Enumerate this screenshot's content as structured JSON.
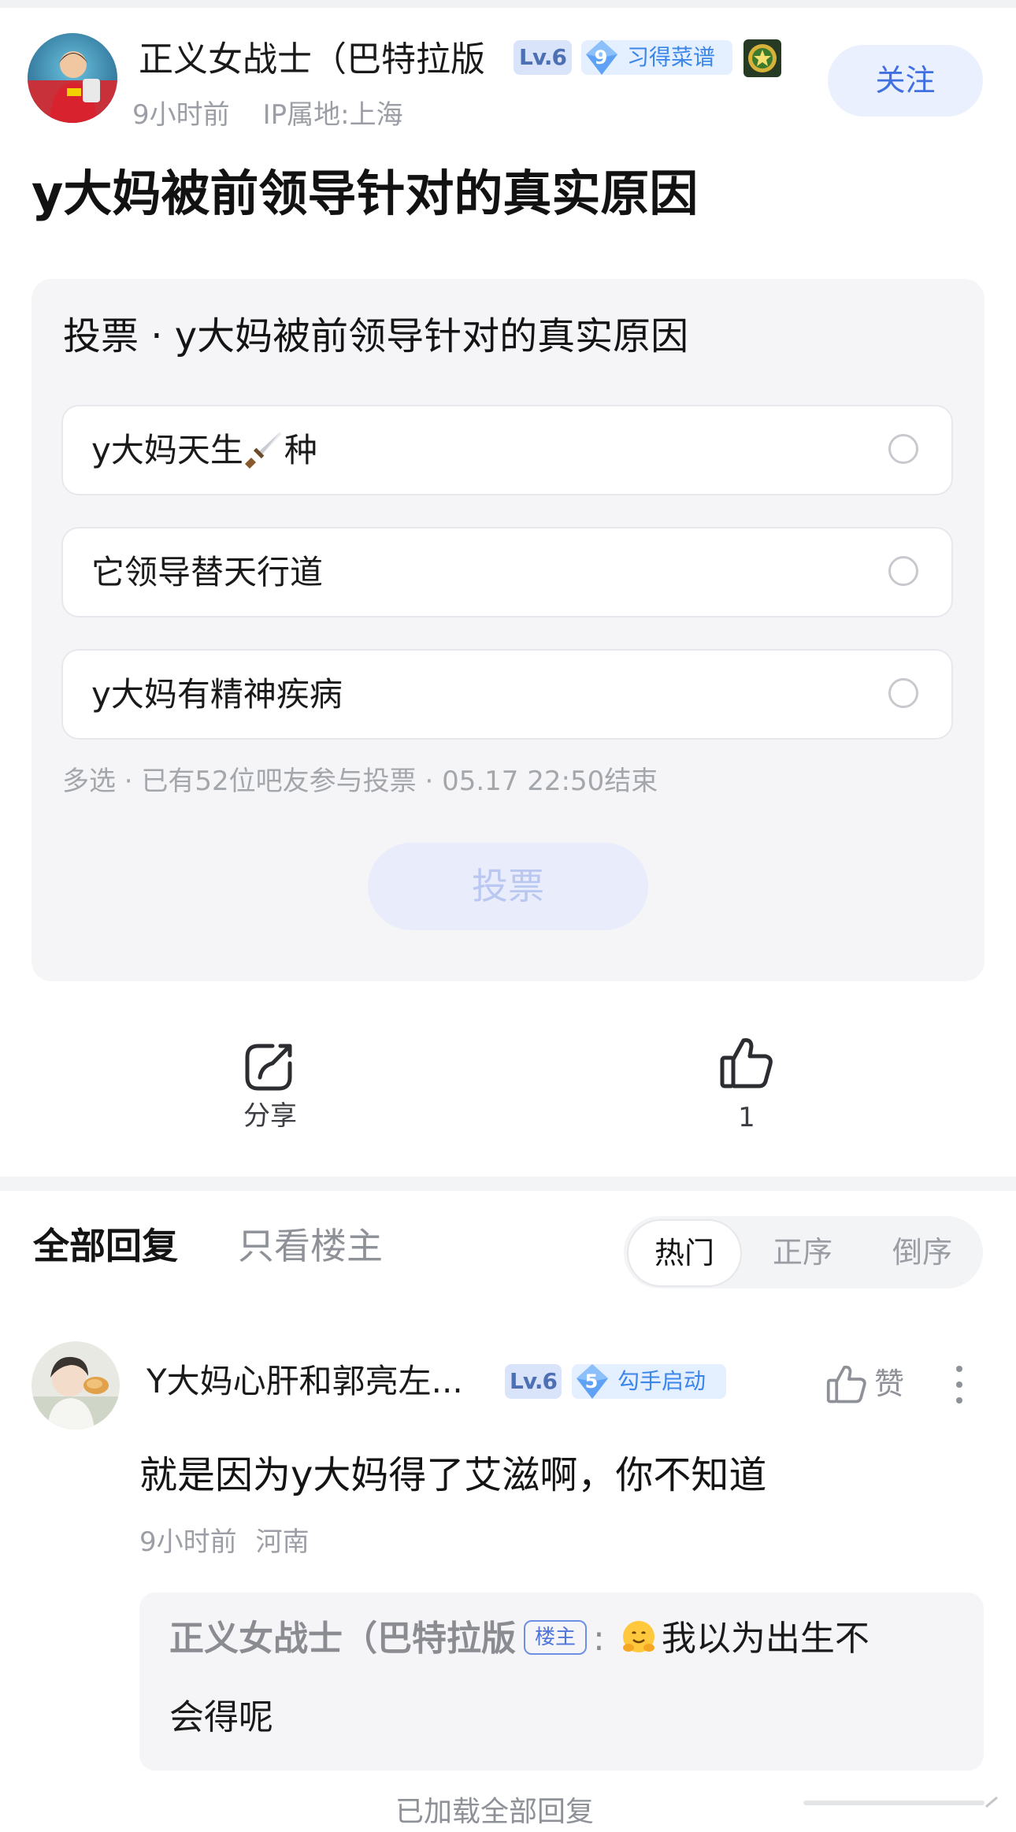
{
  "post": {
    "author": {
      "name": "正义女战士（巴特拉版",
      "level": "Lv.6",
      "rank_number": "9",
      "rank_title": "习得菜谱"
    },
    "follow_label": "关注",
    "time": "9小时前",
    "ip_location": "IP属地:上海",
    "title": "y大妈被前领导针对的真实原因"
  },
  "vote": {
    "title": "投票 · y大妈被前领导针对的真实原因",
    "options": [
      {
        "label": "y大妈天生🗡️种",
        "text_a": "y大妈天生",
        "text_b": "种",
        "selected": false
      },
      {
        "label": "它领导替天行道",
        "selected": false
      },
      {
        "label": "y大妈有精神疾病",
        "selected": false
      }
    ],
    "info": "多选 · 已有52位吧友参与投票 · 05.17 22:50结束",
    "submit_label": "投票"
  },
  "actions": {
    "share_label": "分享",
    "like_count": "1"
  },
  "replies": {
    "tabs": {
      "all": "全部回复",
      "op_only": "只看楼主"
    },
    "sort": [
      "热门",
      "正序",
      "倒序"
    ],
    "sort_active": "热门"
  },
  "comment": {
    "author": "Y大妈心肝和郭亮左...",
    "level": "Lv.6",
    "rank_number": "5",
    "rank_title": "勾手启动",
    "like_label": "赞",
    "text": "就是因为y大妈得了艾滋啊，你不知道",
    "time": "9小时前",
    "location": "河南",
    "sub_reply": {
      "author": "正义女战士（巴特拉版",
      "op_tag": "楼主",
      "colon": ":",
      "emoji": "🤗",
      "text_line1": "我以为出生不",
      "text_line2": "会得呢"
    },
    "more_partial": "已加载全部回复"
  },
  "colors": {
    "accent_blue": "#3f6fe0",
    "vote_card_bg": "#f5f5f7",
    "meta_gray": "#9b9ea4"
  },
  "icons": [
    "share-icon",
    "thumbs-up-icon",
    "more-vertical-icon",
    "medal-icon",
    "gem-icon",
    "dagger-icon",
    "hug-emoji-icon"
  ]
}
